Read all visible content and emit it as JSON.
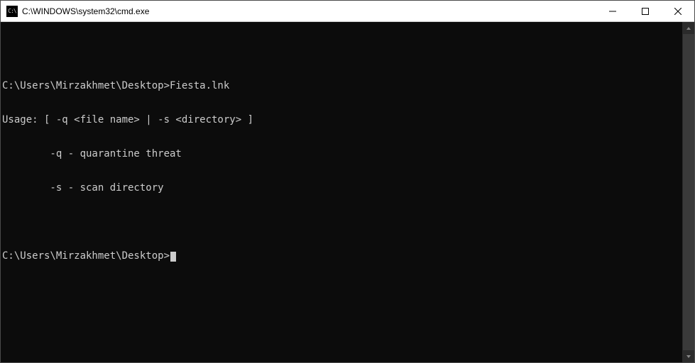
{
  "titlebar": {
    "icon_label": "C:\\",
    "title": "C:\\WINDOWS\\system32\\cmd.exe"
  },
  "window_controls": {
    "minimize": "Minimize",
    "maximize": "Maximize",
    "close": "Close"
  },
  "terminal": {
    "lines": [
      "",
      "C:\\Users\\Mirzakhmet\\Desktop>Fiesta.lnk",
      "Usage: [ -q <file name> | -s <directory> ]",
      "        -q - quarantine threat",
      "        -s - scan directory",
      "",
      "C:\\Users\\Mirzakhmet\\Desktop>"
    ],
    "cursor_visible": true
  },
  "colors": {
    "bg": "#0c0c0c",
    "fg": "#cccccc",
    "titlebar_bg": "#ffffff",
    "titlebar_fg": "#000000"
  }
}
